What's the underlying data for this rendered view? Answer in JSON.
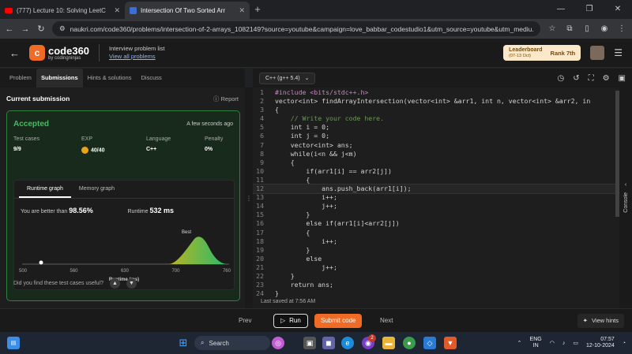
{
  "browser": {
    "tabs": [
      {
        "label": "(777) Lecture 10: Solving LeetC",
        "icon": "youtube-icon"
      },
      {
        "label": "Intersection Of Two Sorted Arr",
        "icon": "coding-ninjas-icon"
      }
    ],
    "url": "naukri.com/code360/problems/intersection-of-2-arrays_1082149?source=youtube&campaign=love_babbar_codestudio1&utm_source=youtube&utm_mediu..."
  },
  "header": {
    "logo_main": "code360",
    "logo_sub": "by codingninjas",
    "list_title": "Interview problem list",
    "list_link": "View all problems",
    "leaderboard_label": "Leaderboard",
    "leaderboard_date": "(07-13 Oct)",
    "rank": "Rank 7th"
  },
  "left_tabs": [
    "Problem",
    "Submissions",
    "Hints & solutions",
    "Discuss"
  ],
  "editor_lang": "C++ (g++ 5.4)",
  "submission": {
    "title": "Current submission",
    "report": "Report",
    "status": "Accepted",
    "time": "A few seconds ago",
    "stats": [
      {
        "label": "Test cases",
        "value": "9/9"
      },
      {
        "label": "EXP",
        "value": "40/40"
      },
      {
        "label": "Language",
        "value": "C++"
      },
      {
        "label": "Penalty",
        "value": "0%"
      }
    ],
    "graph_tabs": [
      "Runtime graph",
      "Memory graph"
    ],
    "better_text": "You are better than",
    "better_value": "98.56%",
    "runtime_label": "Runtime",
    "runtime_value": "532 ms",
    "best_label": "Best",
    "x_ticks": [
      "500",
      "560",
      "630",
      "700",
      "760"
    ],
    "x_label": "Runtime (ms)",
    "useful_text": "Did you find these test cases useful?"
  },
  "code_lines": [
    "#include <bits/stdc++.h>",
    "vector<int> findArrayIntersection(vector<int> &arr1, int n, vector<int> &arr2, in",
    "{",
    "    // Write your code here.",
    "    int i = 0;",
    "    int j = 0;",
    "    vector<int> ans;",
    "    while(i<n && j<m)",
    "    {",
    "        if(arr1[i] == arr2[j])",
    "        {",
    "            ans.push_back(arr1[i]);",
    "            i++;",
    "            j++;",
    "        }",
    "        else if(arr1[i]<arr2[j])",
    "        {",
    "            i++;",
    "        }",
    "        else",
    "            j++;",
    "    }",
    "    return ans;",
    "}"
  ],
  "status_bar": "Last saved at 7:56 AM",
  "bottom": {
    "prev": "Prev",
    "run": "Run",
    "submit": "Submit code",
    "next": "Next",
    "hints": "View hints",
    "console": "Console"
  },
  "taskbar": {
    "search": "Search",
    "lang": "ENG",
    "region": "IN",
    "time": "07:57",
    "date": "12-10-2024",
    "badge": "2"
  }
}
